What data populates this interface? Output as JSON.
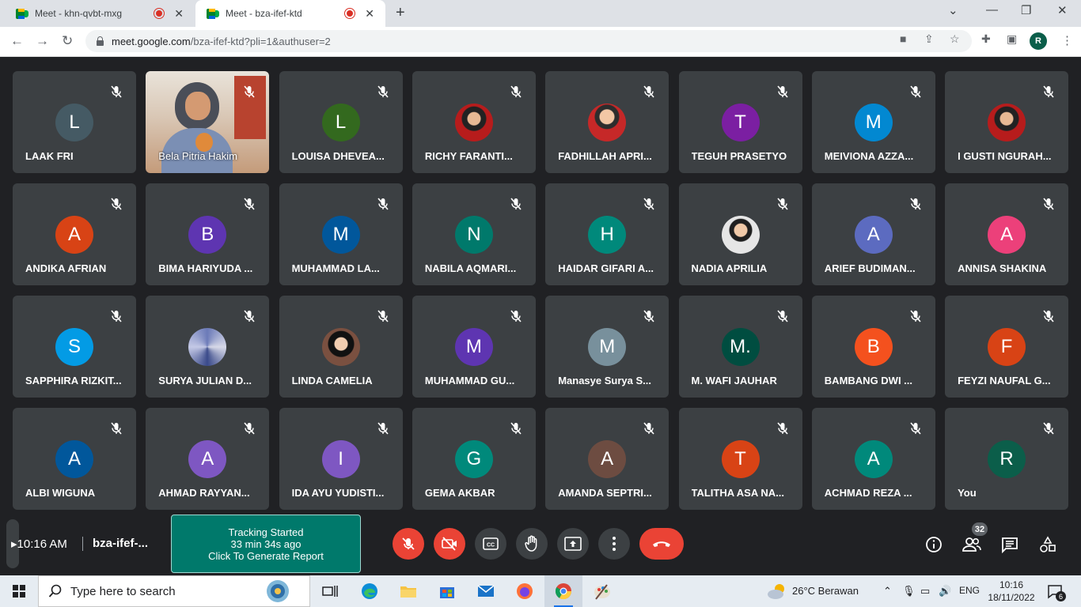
{
  "browser": {
    "tabs": [
      {
        "title": "Meet - khn-qvbt-mxg",
        "active": false
      },
      {
        "title": "Meet - bza-ifef-ktd",
        "active": true
      }
    ],
    "url_host": "meet.google.com",
    "url_path": "/bza-ifef-ktd?pli=1&authuser=2",
    "profile_initial": "R"
  },
  "participants": [
    {
      "name": "LAAK FRI",
      "initial": "L",
      "color": "#455a64"
    },
    {
      "name": "Bela Pitria Hakim",
      "initial": "",
      "color": "",
      "video": true
    },
    {
      "name": "LOUISA DHEVEA...",
      "initial": "L",
      "color": "#33691e"
    },
    {
      "name": "RICHY FARANTI...",
      "initial": "",
      "color": "",
      "photo": "photo3"
    },
    {
      "name": "FADHILLAH APRI...",
      "initial": "",
      "color": "",
      "photo": "photo"
    },
    {
      "name": "TEGUH PRASETYO",
      "initial": "T",
      "color": "#7b1fa2"
    },
    {
      "name": "MEIVIONA AZZA...",
      "initial": "M",
      "color": "#0288d1"
    },
    {
      "name": "I GUSTI NGURAH...",
      "initial": "",
      "color": "",
      "photo": "photo3"
    },
    {
      "name": "ANDIKA AFRIAN",
      "initial": "A",
      "color": "#d84315"
    },
    {
      "name": "BIMA HARIYUDA ...",
      "initial": "B",
      "color": "#5e35b1"
    },
    {
      "name": "MUHAMMAD LA...",
      "initial": "M",
      "color": "#01579b"
    },
    {
      "name": "NABILA AQMARI...",
      "initial": "N",
      "color": "#00796b"
    },
    {
      "name": "HAIDAR GIFARI A...",
      "initial": "H",
      "color": "#00897b"
    },
    {
      "name": "NADIA APRILIA",
      "initial": "",
      "color": "",
      "photo": "photo2"
    },
    {
      "name": "ARIEF BUDIMAN...",
      "initial": "A",
      "color": "#5c6bc0"
    },
    {
      "name": "ANNISA SHAKINA",
      "initial": "A",
      "color": "#ec407a"
    },
    {
      "name": "SAPPHIRA RIZKIT...",
      "initial": "S",
      "color": "#039be5"
    },
    {
      "name": "SURYA JULIAN D...",
      "initial": "",
      "color": "",
      "photo": "photo4"
    },
    {
      "name": "LINDA CAMELIA",
      "initial": "",
      "color": "",
      "photo": "photo5"
    },
    {
      "name": "MUHAMMAD GU...",
      "initial": "M",
      "color": "#5e35b1"
    },
    {
      "name": "Manasye Surya S...",
      "initial": "M",
      "color": "#78909c"
    },
    {
      "name": "M. WAFI JAUHAR",
      "initial": "M.",
      "color": "#004d40"
    },
    {
      "name": "BAMBANG DWI ...",
      "initial": "B",
      "color": "#f4511e"
    },
    {
      "name": "FEYZI NAUFAL G...",
      "initial": "F",
      "color": "#d84315"
    },
    {
      "name": "ALBI WIGUNA",
      "initial": "A",
      "color": "#01579b"
    },
    {
      "name": "AHMAD RAYYAN...",
      "initial": "A",
      "color": "#7e57c2"
    },
    {
      "name": "IDA AYU YUDISTI...",
      "initial": "I",
      "color": "#7e57c2"
    },
    {
      "name": "GEMA AKBAR",
      "initial": "G",
      "color": "#00897b"
    },
    {
      "name": "AMANDA SEPTRI...",
      "initial": "A",
      "color": "#6d4c41"
    },
    {
      "name": "TALITHA ASA NA...",
      "initial": "T",
      "color": "#d84315"
    },
    {
      "name": "ACHMAD REZA ...",
      "initial": "A",
      "color": "#00897b"
    },
    {
      "name": "You",
      "initial": "R",
      "color": "#0b5e4a"
    }
  ],
  "meeting": {
    "time": "10:16 AM",
    "separator": "|",
    "code": "bza-ifef-...",
    "participant_count": "32"
  },
  "tracking": {
    "line1": "Tracking Started",
    "line2": "33 min 34s ago",
    "line3": "Click To Generate Report"
  },
  "taskbar": {
    "search_placeholder": "Type here to search",
    "weather": "26°C  Berawan",
    "lang": "ENG",
    "clock_time": "10:16",
    "clock_date": "18/11/2022",
    "notifications": "6"
  }
}
